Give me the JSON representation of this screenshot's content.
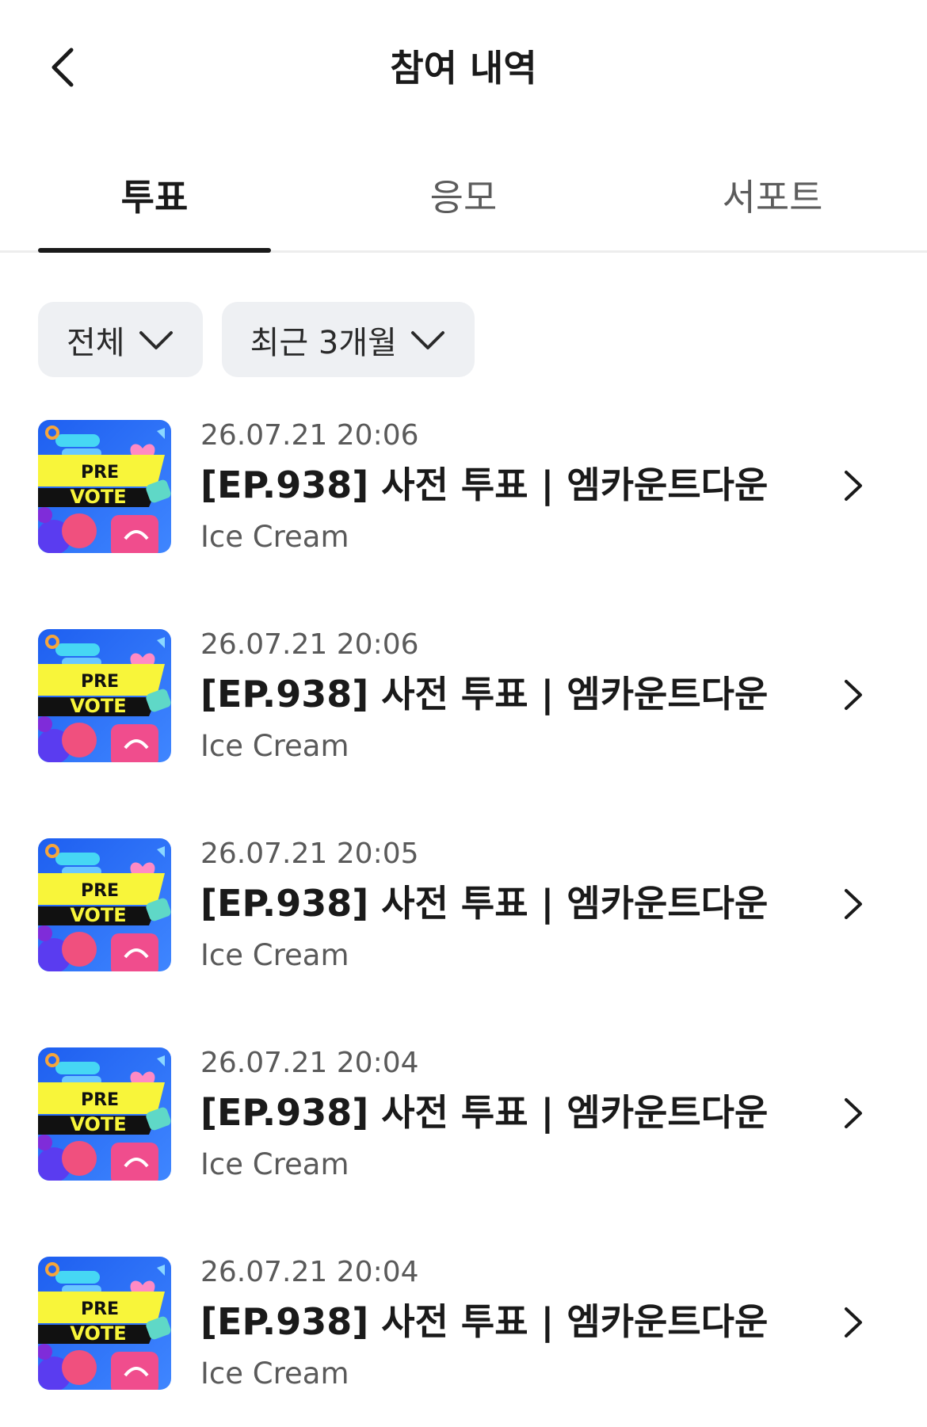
{
  "header": {
    "back_icon": "chevron-left-icon",
    "title": "참여 내역"
  },
  "tabs": [
    {
      "label": "투표",
      "active": true
    },
    {
      "label": "응모",
      "active": false
    },
    {
      "label": "서포트",
      "active": false
    }
  ],
  "filters": [
    {
      "label": "전체",
      "icon": "chevron-down-icon"
    },
    {
      "label": "최근 3개월",
      "icon": "chevron-down-icon"
    }
  ],
  "thumbnail_text": {
    "line1": "PRE",
    "line2": "VOTE"
  },
  "colors": {
    "text_primary": "#1a1a1a",
    "text_secondary": "#5a5a5a",
    "filter_bg": "#eef0f3",
    "thumb_blue": "#2f6df0",
    "thumb_yellow": "#f8f53a",
    "thumb_pink": "#f04d8d"
  },
  "items": [
    {
      "date": "26.07.21 20:06",
      "title": "[EP.938] 사전 투표 | 엠카운트다운",
      "subtitle": "Ice Cream",
      "arrow_icon": "chevron-right-icon"
    },
    {
      "date": "26.07.21 20:06",
      "title": "[EP.938] 사전 투표 | 엠카운트다운",
      "subtitle": "Ice Cream",
      "arrow_icon": "chevron-right-icon"
    },
    {
      "date": "26.07.21 20:05",
      "title": "[EP.938] 사전 투표 | 엠카운트다운",
      "subtitle": "Ice Cream",
      "arrow_icon": "chevron-right-icon"
    },
    {
      "date": "26.07.21 20:04",
      "title": "[EP.938] 사전 투표 | 엠카운트다운",
      "subtitle": "Ice Cream",
      "arrow_icon": "chevron-right-icon"
    },
    {
      "date": "26.07.21 20:04",
      "title": "[EP.938] 사전 투표 | 엠카운트다운",
      "subtitle": "Ice Cream",
      "arrow_icon": "chevron-right-icon"
    }
  ]
}
